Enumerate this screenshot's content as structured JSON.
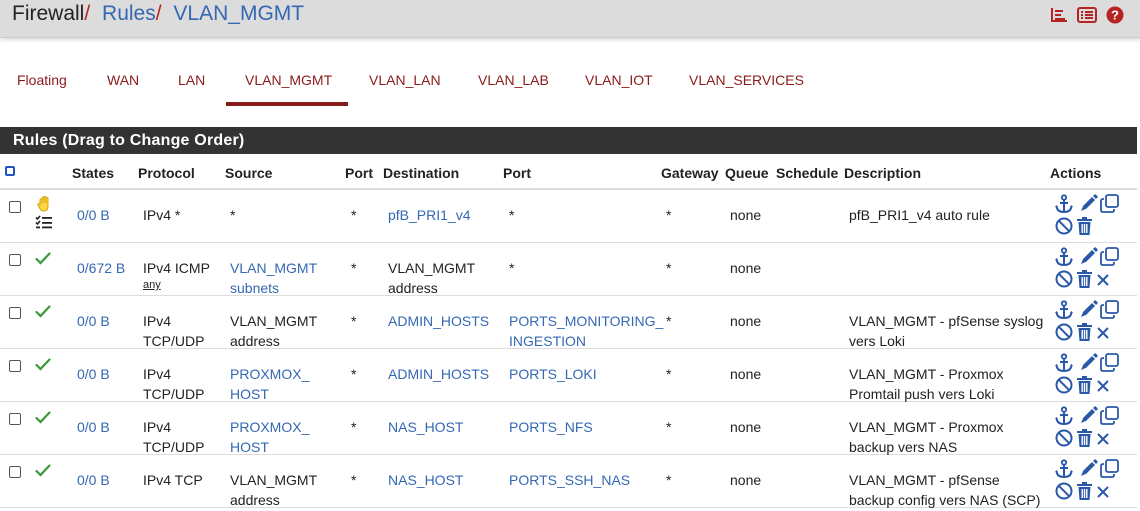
{
  "header": {
    "breadcrumb": [
      "Firewall",
      "Rules",
      "VLAN_MGMT"
    ],
    "icons": [
      "chart-icon",
      "list-icon",
      "help-icon"
    ]
  },
  "tabs": [
    "Floating",
    "WAN",
    "LAN",
    "VLAN_MGMT",
    "VLAN_LAN",
    "VLAN_LAB",
    "VLAN_IOT",
    "VLAN_SERVICES"
  ],
  "active_tab": "VLAN_MGMT",
  "panel_title": "Rules (Drag to Change Order)",
  "columns": [
    "States",
    "Protocol",
    "Source",
    "Port",
    "Destination",
    "Port",
    "Gateway",
    "Queue",
    "Schedule",
    "Description",
    "Actions"
  ],
  "rows": [
    {
      "status_icon": "hand-icon",
      "states": "0/0 B",
      "protocol": [
        "IPv4 *"
      ],
      "source": [
        "*"
      ],
      "source_link": false,
      "sport": "*",
      "destination": [
        "pfB_PRI1_v4"
      ],
      "destination_link": true,
      "dport": [
        "*"
      ],
      "dport_link": false,
      "gateway": "*",
      "queue": "none",
      "schedule": "",
      "description": [
        "pfB_PRI1_v4 auto rule"
      ],
      "actions": [
        "anchor-icon",
        "edit-icon",
        "copy-icon",
        "block-icon",
        "trash-icon"
      ]
    },
    {
      "status_icon": "check-icon",
      "states": "0/672 B",
      "protocol": [
        "IPv4 ICMP",
        "any"
      ],
      "source": [
        "VLAN_MGMT",
        "subnets"
      ],
      "source_link": true,
      "sport": "*",
      "destination": [
        "VLAN_MGMT",
        "address"
      ],
      "destination_link": false,
      "dport": [
        "*"
      ],
      "dport_link": false,
      "gateway": "*",
      "queue": "none",
      "schedule": "",
      "description": [],
      "actions": [
        "anchor-icon",
        "edit-icon",
        "copy-icon",
        "block-icon",
        "trash-icon",
        "delete-x-icon"
      ]
    },
    {
      "status_icon": "check-icon",
      "states": "0/0 B",
      "protocol": [
        "IPv4",
        "TCP/UDP"
      ],
      "source": [
        "VLAN_MGMT",
        "address"
      ],
      "source_link": false,
      "sport": "*",
      "destination": [
        "ADMIN_HOSTS"
      ],
      "destination_link": true,
      "dport": [
        "PORTS_MONITORING_",
        "INGESTION"
      ],
      "dport_link": true,
      "gateway": "*",
      "queue": "none",
      "schedule": "",
      "description": [
        "VLAN_MGMT - pfSense syslog",
        "vers Loki"
      ],
      "actions": [
        "anchor-icon",
        "edit-icon",
        "copy-icon",
        "block-icon",
        "trash-icon",
        "delete-x-icon"
      ]
    },
    {
      "status_icon": "check-icon",
      "states": "0/0 B",
      "protocol": [
        "IPv4",
        "TCP/UDP"
      ],
      "source": [
        "PROXMOX_",
        "HOST"
      ],
      "source_link": true,
      "sport": "*",
      "destination": [
        "ADMIN_HOSTS"
      ],
      "destination_link": true,
      "dport": [
        "PORTS_LOKI"
      ],
      "dport_link": true,
      "gateway": "*",
      "queue": "none",
      "schedule": "",
      "description": [
        "VLAN_MGMT - Proxmox",
        "Promtail push vers Loki"
      ],
      "actions": [
        "anchor-icon",
        "edit-icon",
        "copy-icon",
        "block-icon",
        "trash-icon",
        "delete-x-icon"
      ]
    },
    {
      "status_icon": "check-icon",
      "states": "0/0 B",
      "protocol": [
        "IPv4",
        "TCP/UDP"
      ],
      "source": [
        "PROXMOX_",
        "HOST"
      ],
      "source_link": true,
      "sport": "*",
      "destination": [
        "NAS_HOST"
      ],
      "destination_link": true,
      "dport": [
        "PORTS_NFS"
      ],
      "dport_link": true,
      "gateway": "*",
      "queue": "none",
      "schedule": "",
      "description": [
        "VLAN_MGMT - Proxmox",
        "backup vers NAS"
      ],
      "actions": [
        "anchor-icon",
        "edit-icon",
        "copy-icon",
        "block-icon",
        "trash-icon",
        "delete-x-icon"
      ]
    },
    {
      "status_icon": "check-icon",
      "states": "0/0 B",
      "protocol": [
        "IPv4 TCP"
      ],
      "source": [
        "VLAN_MGMT",
        "address"
      ],
      "source_link": false,
      "sport": "*",
      "destination": [
        "NAS_HOST"
      ],
      "destination_link": true,
      "dport": [
        "PORTS_SSH_NAS"
      ],
      "dport_link": true,
      "gateway": "*",
      "queue": "none",
      "schedule": "",
      "description": [
        "VLAN_MGMT - pfSense",
        "backup config vers NAS (SCP)"
      ],
      "actions": [
        "anchor-icon",
        "edit-icon",
        "copy-icon",
        "block-icon",
        "trash-icon",
        "delete-x-icon"
      ]
    }
  ],
  "colors": {
    "link": "#3468b4",
    "accent": "#8b1a1a",
    "check": "#3a9a3a",
    "panel": "#333333"
  }
}
